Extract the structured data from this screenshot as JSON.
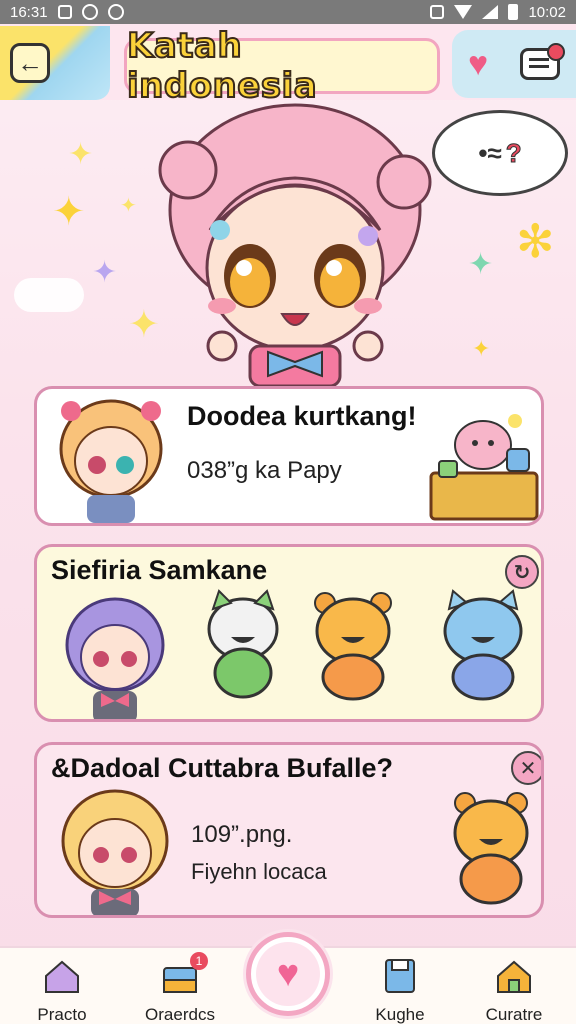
{
  "status_bar": {
    "time_left": "16:31",
    "time_right": "10:02"
  },
  "header": {
    "title": "Katah indonesia"
  },
  "hero": {
    "speech_mark": "?"
  },
  "cards": [
    {
      "title": "Doodea kurtkang!",
      "subtitle": "038”g ka Papy"
    },
    {
      "title": "Siefiria Samkane"
    },
    {
      "title": "&Dadoal Cuttabra Bufalle?",
      "line1": "109”.png.",
      "line2": "Fiyehn locaca"
    }
  ],
  "bottom_nav": {
    "items": [
      {
        "label": "Practo"
      },
      {
        "label": "Oraerdcs",
        "badge": "1"
      },
      {
        "label": "Kughe"
      },
      {
        "label": "Curatre"
      }
    ]
  },
  "colors": {
    "accent_pink": "#f3a7c3",
    "heart": "#ef5c86",
    "title_yellow": "#fbd23a"
  }
}
